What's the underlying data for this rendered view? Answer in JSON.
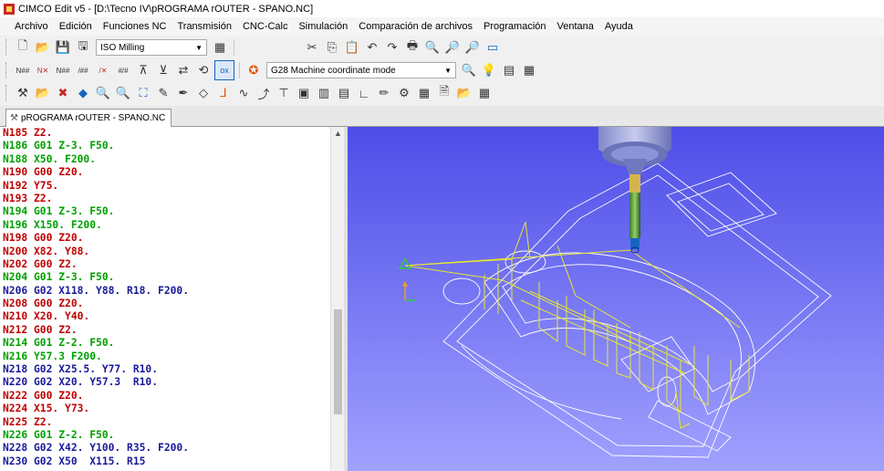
{
  "window": {
    "title": "CIMCO Edit v5 - [D:\\Tecno IV\\pROGRAMA rOUTER - SPANO.NC]"
  },
  "menu": [
    "Archivo",
    "Edición",
    "Funciones NC",
    "Transmisión",
    "CNC-Calc",
    "Simulación",
    "Comparación de archivos",
    "Programación",
    "Ventana",
    "Ayuda"
  ],
  "toolbar1": {
    "machine_combo": "ISO Milling"
  },
  "toolbar2": {
    "mode_combo": "G28 Machine coordinate mode",
    "ox_label": "ox"
  },
  "tab": {
    "label": "pROGRAMA rOUTER - SPANO.NC"
  },
  "code_lines": [
    {
      "text": "N185 Z2.",
      "color": "red"
    },
    {
      "text": "N186 G01 Z-3. F50.",
      "color": "green"
    },
    {
      "text": "N188 X50. F200.",
      "color": "green"
    },
    {
      "text": "N190 G00 Z20.",
      "color": "red"
    },
    {
      "text": "N192 Y75.",
      "color": "red"
    },
    {
      "text": "N193 Z2.",
      "color": "red"
    },
    {
      "text": "N194 G01 Z-3. F50.",
      "color": "green"
    },
    {
      "text": "N196 X150. F200.",
      "color": "green"
    },
    {
      "text": "N198 G00 Z20.",
      "color": "red"
    },
    {
      "text": "N200 X82. Y88.",
      "color": "red"
    },
    {
      "text": "N202 G00 Z2.",
      "color": "red"
    },
    {
      "text": "N204 G01 Z-3. F50.",
      "color": "green"
    },
    {
      "text": "N206 G02 X118. Y88. R18. F200.",
      "color": "blue"
    },
    {
      "text": "N208 G00 Z20.",
      "color": "red"
    },
    {
      "text": "N210 X20. Y40.",
      "color": "red"
    },
    {
      "text": "N212 G00 Z2.",
      "color": "red"
    },
    {
      "text": "N214 G01 Z-2. F50.",
      "color": "green"
    },
    {
      "text": "N216 Y57.3 F200.",
      "color": "green"
    },
    {
      "text": "N218 G02 X25.5. Y77. R10.",
      "color": "blue"
    },
    {
      "text": "N220 G02 X20. Y57.3  R10.",
      "color": "blue"
    },
    {
      "text": "N222 G00 Z20.",
      "color": "red"
    },
    {
      "text": "N224 X15. Y73.",
      "color": "red"
    },
    {
      "text": "N225 Z2.",
      "color": "red"
    },
    {
      "text": "N226 G01 Z-2. F50.",
      "color": "green"
    },
    {
      "text": "N228 G02 X42. Y100. R35. F200.",
      "color": "blue"
    },
    {
      "text": "N230 G02 X50  X115. R15",
      "color": "blue"
    }
  ],
  "colors": {
    "rapid": "#c00000",
    "linear": "#00a000",
    "arc": "#1a1a9a",
    "viewport_top": "#4d4de8",
    "viewport_bottom": "#a1a1ff",
    "toolpath": "#e8e830"
  }
}
